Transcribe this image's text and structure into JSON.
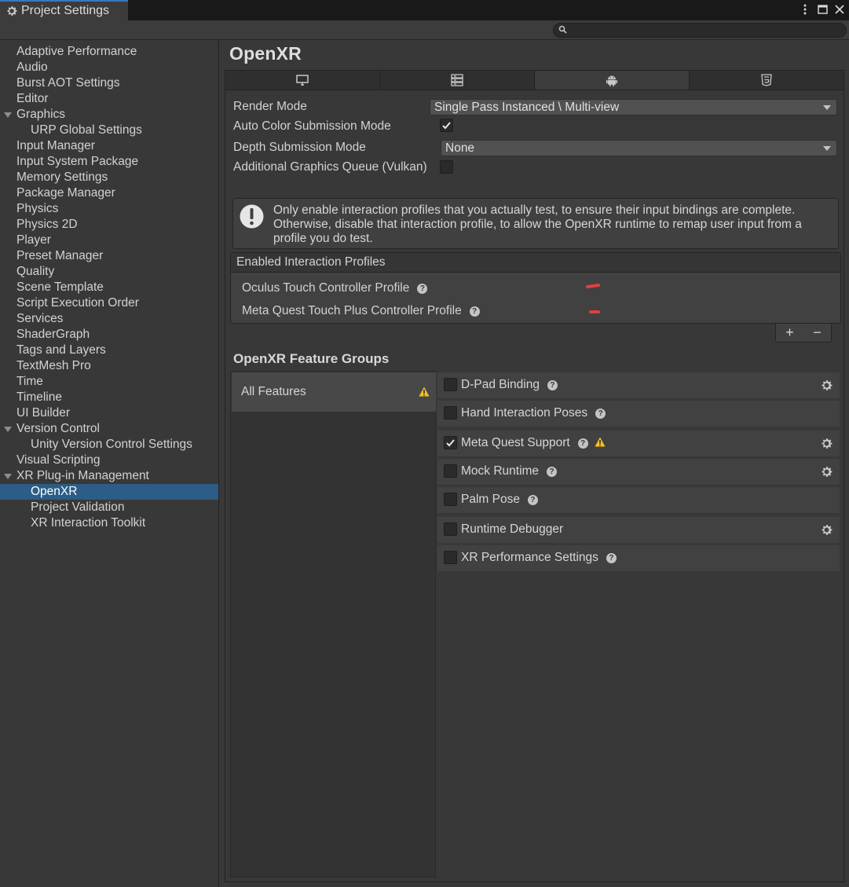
{
  "window": {
    "tab_title": "Project Settings",
    "controls": [
      "menu-icon",
      "maximize-icon",
      "close-icon"
    ]
  },
  "search": {
    "placeholder": ""
  },
  "sidebar": {
    "items": [
      {
        "label": "Adaptive Performance",
        "level": 0
      },
      {
        "label": "Audio",
        "level": 0
      },
      {
        "label": "Burst AOT Settings",
        "level": 0
      },
      {
        "label": "Editor",
        "level": 0
      },
      {
        "label": "Graphics",
        "level": 0,
        "foldout": true
      },
      {
        "label": "URP Global Settings",
        "level": 1
      },
      {
        "label": "Input Manager",
        "level": 0
      },
      {
        "label": "Input System Package",
        "level": 0
      },
      {
        "label": "Memory Settings",
        "level": 0
      },
      {
        "label": "Package Manager",
        "level": 0
      },
      {
        "label": "Physics",
        "level": 0
      },
      {
        "label": "Physics 2D",
        "level": 0
      },
      {
        "label": "Player",
        "level": 0
      },
      {
        "label": "Preset Manager",
        "level": 0
      },
      {
        "label": "Quality",
        "level": 0
      },
      {
        "label": "Scene Template",
        "level": 0
      },
      {
        "label": "Script Execution Order",
        "level": 0
      },
      {
        "label": "Services",
        "level": 0
      },
      {
        "label": "ShaderGraph",
        "level": 0
      },
      {
        "label": "Tags and Layers",
        "level": 0
      },
      {
        "label": "TextMesh Pro",
        "level": 0
      },
      {
        "label": "Time",
        "level": 0
      },
      {
        "label": "Timeline",
        "level": 0
      },
      {
        "label": "UI Builder",
        "level": 0
      },
      {
        "label": "Version Control",
        "level": 0,
        "foldout": true
      },
      {
        "label": "Unity Version Control Settings",
        "level": 1
      },
      {
        "label": "Visual Scripting",
        "level": 0
      },
      {
        "label": "XR Plug-in Management",
        "level": 0,
        "foldout": true
      },
      {
        "label": "OpenXR",
        "level": 1,
        "selected": true
      },
      {
        "label": "Project Validation",
        "level": 1
      },
      {
        "label": "XR Interaction Toolkit",
        "level": 1
      }
    ]
  },
  "main": {
    "title": "OpenXR",
    "platform_tabs": [
      {
        "icon": "desktop-icon",
        "active": false
      },
      {
        "icon": "server-icon",
        "active": false
      },
      {
        "icon": "android-icon",
        "active": true
      },
      {
        "icon": "html5-icon",
        "active": false
      }
    ],
    "render_mode": {
      "label": "Render Mode",
      "value": "Single Pass Instanced \\ Multi-view"
    },
    "auto_color": {
      "label": "Auto Color Submission Mode",
      "checked": true
    },
    "depth_mode": {
      "label": "Depth Submission Mode",
      "value": "None"
    },
    "graphics_queue": {
      "label": "Additional Graphics Queue (Vulkan)",
      "checked": false
    },
    "help_text": "Only enable interaction profiles that you actually test, to ensure their input bindings are complete. Otherwise, disable that interaction profile, to allow the OpenXR runtime to remap user input from a profile you do test.",
    "profiles": {
      "header": "Enabled Interaction Profiles",
      "items": [
        "Oculus Touch Controller Profile",
        "Meta Quest Touch Plus Controller Profile"
      ],
      "add_label": "+",
      "remove_label": "−"
    },
    "feature_groups": {
      "title": "OpenXR Feature Groups",
      "groups": [
        {
          "label": "All Features",
          "warning": true
        }
      ],
      "features": [
        {
          "label": "D-Pad Binding",
          "checked": false,
          "help": true,
          "warning": false,
          "gear": true
        },
        {
          "label": "Hand Interaction Poses",
          "checked": false,
          "help": true,
          "warning": false,
          "gear": false
        },
        {
          "label": "Meta Quest Support",
          "checked": true,
          "help": true,
          "warning": true,
          "gear": true
        },
        {
          "label": "Mock Runtime",
          "checked": false,
          "help": true,
          "warning": false,
          "gear": true
        },
        {
          "label": "Palm Pose",
          "checked": false,
          "help": true,
          "warning": false,
          "gear": false
        },
        {
          "label": "Runtime Debugger",
          "checked": false,
          "help": false,
          "warning": false,
          "gear": true
        },
        {
          "label": "XR Performance Settings",
          "checked": false,
          "help": true,
          "warning": false,
          "gear": false
        }
      ]
    }
  },
  "colors": {
    "selection": "#2c5d87",
    "tab_accent": "#3a79bb",
    "warning": "#f4c21b",
    "annotation_red": "#e0403f"
  }
}
